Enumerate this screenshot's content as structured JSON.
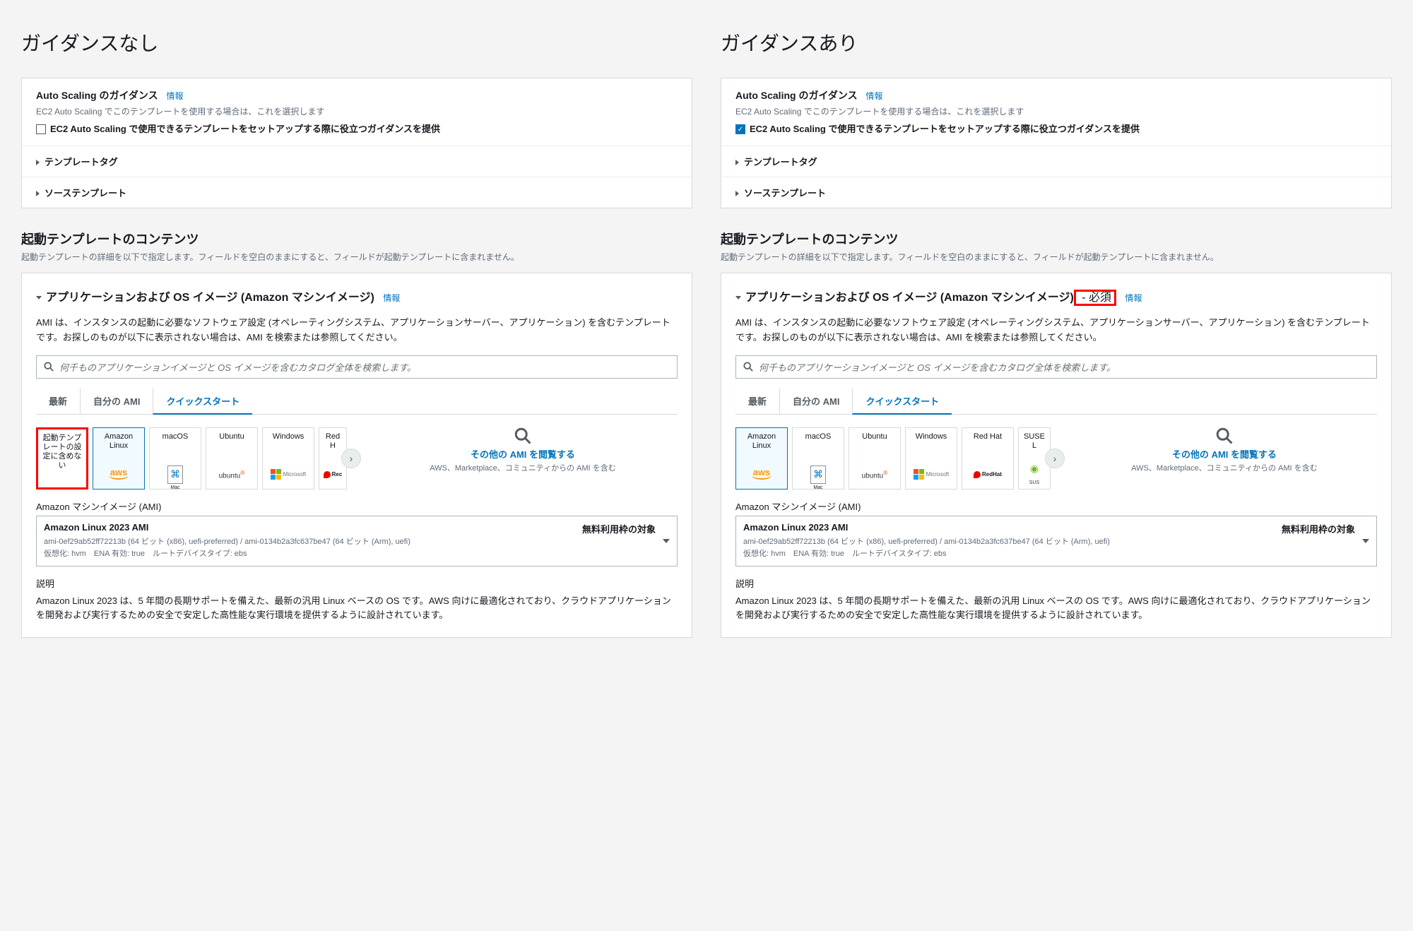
{
  "left": {
    "heading": "ガイダンスなし",
    "guidance": {
      "title": "Auto Scaling のガイダンス",
      "info": "情報",
      "subtitle": "EC2 Auto Scaling でこのテンプレートを使用する場合は、これを選択します",
      "checkbox_label": "EC2 Auto Scaling で使用できるテンプレートをセットアップする際に役立つガイダンスを提供",
      "checked": false
    },
    "expanders": {
      "e1": "テンプレートタグ",
      "e2": "ソーステンプレート"
    },
    "contents": {
      "head": "起動テンプレートのコンテンツ",
      "sub": "起動テンプレートの詳細を以下で指定します。フィールドを空白のままにすると、フィールドが起動テンプレートに含まれません。"
    },
    "app": {
      "title": "アプリケーションおよび OS イメージ (Amazon マシンイメージ)",
      "info": "情報",
      "desc": "AMI は、インスタンスの起動に必要なソフトウェア設定 (オペレーティングシステム、アプリケーションサーバー、アプリケーション) を含むテンプレートです。お探しのものが以下に表示されない場合は、AMI を検索または参照してください。",
      "search_ph": "何千ものアプリケーションイメージと OS イメージを含むカタログ全体を検索します。",
      "tabs": {
        "t1": "最新",
        "t2": "自分の AMI",
        "t3": "クイックスタート"
      },
      "cards": {
        "c0": "起動テンプレートの設定に含めない",
        "c1": "Amazon Linux",
        "c2": "macOS",
        "c3": "Ubuntu",
        "c4": "Windows",
        "c5": "Red H"
      },
      "browse": {
        "link": "その他の AMI を閲覧する",
        "sub": "AWS、Marketplace、コミュニティからの AMI を含む"
      },
      "ami_label": "Amazon マシンイメージ (AMI)",
      "sel": {
        "name": "Amazon Linux 2023 AMI",
        "free": "無料利用枠の対象",
        "line1": "ami-0ef29ab52ff72213b (64 ビット (x86), uefi-preferred) / ami-0134b2a3fc637be47 (64 ビット (Arm), uefi)",
        "line2": "仮想化: hvm　ENA 有効: true　ルートデバイスタイプ: ebs"
      },
      "d_head": "説明",
      "d_body": "Amazon Linux 2023 は、5 年間の長期サポートを備えた、最新の汎用 Linux ベースの OS です。AWS 向けに最適化されており、クラウドアプリケーションを開発および実行するための安全で安定した高性能な実行環境を提供するように設計されています。"
    }
  },
  "right": {
    "heading": "ガイダンスあり",
    "guidance": {
      "title": "Auto Scaling のガイダンス",
      "info": "情報",
      "subtitle": "EC2 Auto Scaling でこのテンプレートを使用する場合は、これを選択します",
      "checkbox_label": "EC2 Auto Scaling で使用できるテンプレートをセットアップする際に役立つガイダンスを提供",
      "checked": true
    },
    "expanders": {
      "e1": "テンプレートタグ",
      "e2": "ソーステンプレート"
    },
    "contents": {
      "head": "起動テンプレートのコンテンツ",
      "sub": "起動テンプレートの詳細を以下で指定します。フィールドを空白のままにすると、フィールドが起動テンプレートに含まれません。"
    },
    "app": {
      "title": "アプリケーションおよび OS イメージ (Amazon マシンイメージ)",
      "required": " - 必須",
      "info": "情報",
      "desc": "AMI は、インスタンスの起動に必要なソフトウェア設定 (オペレーティングシステム、アプリケーションサーバー、アプリケーション) を含むテンプレートです。お探しのものが以下に表示されない場合は、AMI を検索または参照してください。",
      "search_ph": "何千ものアプリケーションイメージと OS イメージを含むカタログ全体を検索します。",
      "tabs": {
        "t1": "最新",
        "t2": "自分の AMI",
        "t3": "クイックスタート"
      },
      "cards": {
        "c1": "Amazon Linux",
        "c2": "macOS",
        "c3": "Ubuntu",
        "c4": "Windows",
        "c5": "Red Hat",
        "c6": "SUSE L"
      },
      "browse": {
        "link": "その他の AMI を閲覧する",
        "sub": "AWS、Marketplace、コミュニティからの AMI を含む"
      },
      "ami_label": "Amazon マシンイメージ (AMI)",
      "sel": {
        "name": "Amazon Linux 2023 AMI",
        "free": "無料利用枠の対象",
        "line1": "ami-0ef29ab52ff72213b (64 ビット (x86), uefi-preferred) / ami-0134b2a3fc637be47 (64 ビット (Arm), uefi)",
        "line2": "仮想化: hvm　ENA 有効: true　ルートデバイスタイプ: ebs"
      },
      "d_head": "説明",
      "d_body": "Amazon Linux 2023 は、5 年間の長期サポートを備えた、最新の汎用 Linux ベースの OS です。AWS 向けに最適化されており、クラウドアプリケーションを開発および実行するための安全で安定した高性能な実行環境を提供するように設計されています。"
    }
  }
}
